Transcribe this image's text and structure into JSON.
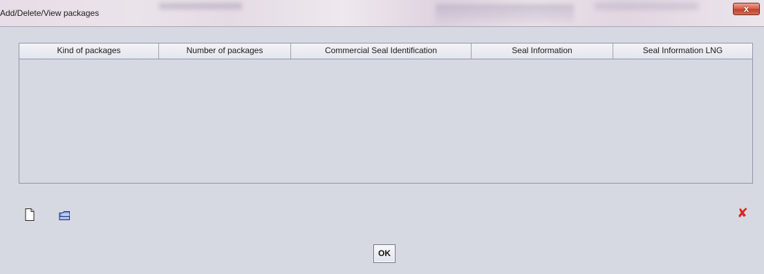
{
  "window": {
    "title": "Add/Delete/View packages",
    "close_label": "x"
  },
  "table": {
    "columns": [
      "Kind of packages",
      "Number of packages",
      "Commercial Seal Identification",
      "Seal Information",
      "Seal Information LNG"
    ],
    "rows": []
  },
  "toolbar": {
    "new_icon": "new-document-icon",
    "open_icon": "open-folder-icon",
    "delete_icon": "delete-x-icon",
    "delete_glyph": "✘"
  },
  "footer": {
    "ok_label": "OK"
  },
  "colors": {
    "background": "#d6d9e2",
    "delete_red": "#e0261e",
    "close_red": "#c2422d"
  }
}
